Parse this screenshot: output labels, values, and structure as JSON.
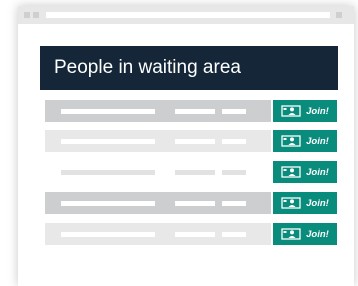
{
  "header": {
    "title": "People in waiting area"
  },
  "waiting_list": {
    "rows": [
      {
        "shade": "#cdced0",
        "join_label": "Join!",
        "join_icon": "video-user-icon"
      },
      {
        "shade": "#e8e8e9",
        "join_label": "Join!",
        "join_icon": "video-user-icon"
      },
      {
        "shade": "#ffffff",
        "join_label": "Join!",
        "join_icon": "video-user-icon"
      },
      {
        "shade": "#cdced0",
        "join_label": "Join!",
        "join_icon": "video-user-icon"
      },
      {
        "shade": "#e8e8e9",
        "join_label": "Join!",
        "join_icon": "video-user-icon"
      }
    ]
  },
  "colors": {
    "header_bg": "#142637",
    "accent": "#0a8c7d",
    "row_dark": "#cdced0",
    "row_light": "#e8e8e9",
    "placeholder_on_white": "#e2e2e3"
  }
}
